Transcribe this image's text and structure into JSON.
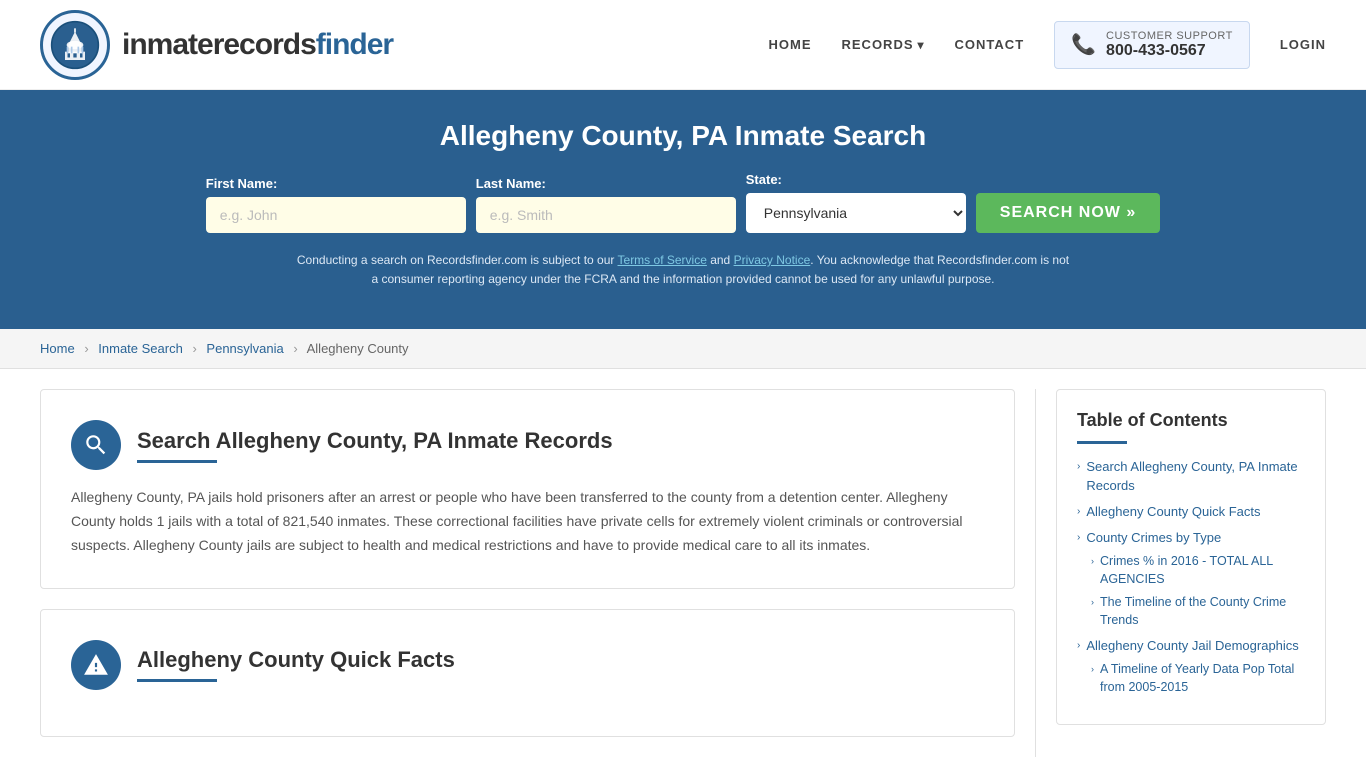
{
  "site": {
    "logo_text_start": "inmaterecords",
    "logo_text_end": "finder"
  },
  "nav": {
    "home_label": "HOME",
    "records_label": "RECORDS",
    "contact_label": "CONTACT",
    "support_label": "CUSTOMER SUPPORT",
    "support_number": "800-433-0567",
    "login_label": "LOGIN"
  },
  "hero": {
    "title": "Allegheny County, PA Inmate Search",
    "first_name_label": "First Name:",
    "first_name_placeholder": "e.g. John",
    "last_name_label": "Last Name:",
    "last_name_placeholder": "e.g. Smith",
    "state_label": "State:",
    "state_value": "Pennsylvania",
    "search_button": "SEARCH NOW »",
    "disclaimer": "Conducting a search on Recordsfinder.com is subject to our Terms of Service and Privacy Notice. You acknowledge that Recordsfinder.com is not a consumer reporting agency under the FCRA and the information provided cannot be used for any unlawful purpose.",
    "tos_link": "Terms of Service",
    "privacy_link": "Privacy Notice"
  },
  "breadcrumb": {
    "home": "Home",
    "inmate_search": "Inmate Search",
    "state": "Pennsylvania",
    "county": "Allegheny County"
  },
  "section1": {
    "title": "Search Allegheny County, PA Inmate Records",
    "body": "Allegheny County, PA jails hold prisoners after an arrest or people who have been transferred to the county from a detention center. Allegheny County holds 1 jails with a total of 821,540 inmates. These correctional facilities have private cells for extremely violent criminals or controversial suspects. Allegheny County jails are subject to health and medical restrictions and have to provide medical care to all its inmates."
  },
  "section2": {
    "title": "Allegheny County Quick Facts"
  },
  "toc": {
    "title": "Table of Contents",
    "items": [
      {
        "label": "Search Allegheny County, PA Inmate Records",
        "subitems": []
      },
      {
        "label": "Allegheny County Quick Facts",
        "subitems": []
      },
      {
        "label": "County Crimes by Type",
        "subitems": []
      },
      {
        "label": "Crimes % in 2016 - TOTAL ALL AGENCIES",
        "subitems": [],
        "indent": true
      },
      {
        "label": "The Timeline of the County Crime Trends",
        "subitems": [],
        "indent": true
      },
      {
        "label": "Allegheny County Jail Demographics",
        "subitems": []
      },
      {
        "label": "A Timeline of Yearly Data Pop Total from 2005-2015",
        "subitems": [],
        "indent": true
      }
    ]
  }
}
